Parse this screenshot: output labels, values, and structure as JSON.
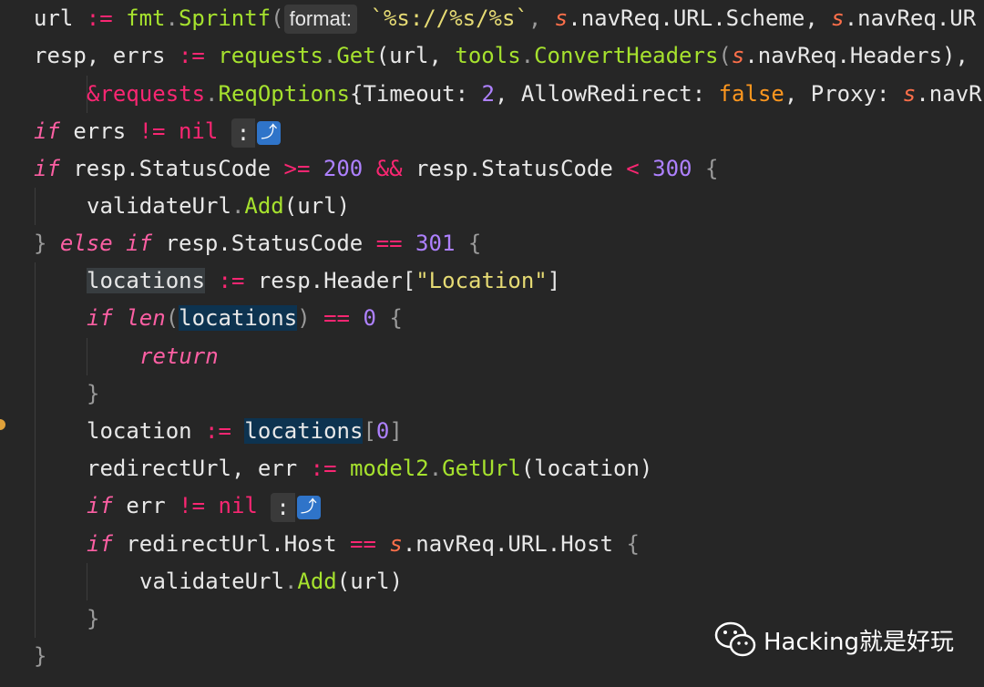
{
  "code": {
    "l1": {
      "a": "url",
      "b": " := ",
      "c": "fmt",
      "d": ".",
      "e": "Sprintf",
      "f": "(",
      "hint": "format:",
      "g": "`%s://%s/%s`",
      "h": ", ",
      "i": "s",
      "j": ".navReq.URL.Scheme, ",
      "k": "s",
      "l": ".navReq.UR"
    },
    "l2": {
      "a": "resp, errs",
      "b": " := ",
      "c": "requests",
      "d": ".",
      "e": "Get",
      "f": "(url, ",
      "g": "tools",
      "h": ".",
      "i": "ConvertHeaders",
      "j": "(",
      "k": "s",
      "l": ".navReq.Headers), "
    },
    "l3": {
      "a": "&requests",
      "b": ".",
      "c": "ReqOptions",
      "d": "{Timeout: ",
      "e": "2",
      "f": ", AllowRedirect: ",
      "g": "false",
      "h": ", Proxy: ",
      "i": "s",
      "j": ".navR"
    },
    "l4": {
      "a": "if",
      "b": " errs ",
      "c": "!=",
      "d": " nil",
      "colon": ":",
      "icon": "⤴"
    },
    "l5": {
      "a": "if",
      "b": " resp.StatusCode ",
      "c": ">=",
      "d": " 200 ",
      "e": "&&",
      "f": " resp.StatusCode ",
      "g": "<",
      "h": " 300 ",
      "i": "{"
    },
    "l6": {
      "a": "validateUrl",
      "b": ".",
      "c": "Add",
      "d": "(url)"
    },
    "l7": {
      "a": "}",
      "b": " else",
      "c": " if",
      "d": " resp.StatusCode ",
      "e": "==",
      "f": " 301 ",
      "g": "{"
    },
    "l8": {
      "a": "locations",
      "b": " := ",
      "c": "resp.Header[",
      "d": "\"Location\"",
      "e": "]"
    },
    "l9": {
      "a": "if",
      "b": " len",
      "c": "(",
      "d": "locations",
      "e": ") ",
      "f": "==",
      "g": " 0 ",
      "h": "{"
    },
    "l10": {
      "a": "return"
    },
    "l11": {
      "a": "}"
    },
    "l12": {
      "a": "location",
      "b": " := ",
      "c": "locations",
      "d": "[",
      "e": "0",
      "f": "]"
    },
    "l13": {
      "a": "redirectUrl, err",
      "b": " := ",
      "c": "model2",
      "d": ".",
      "e": "GetUrl",
      "f": "(location)"
    },
    "l14": {
      "a": "if",
      "b": " err ",
      "c": "!=",
      "d": " nil",
      "colon": ":",
      "icon": "⤴"
    },
    "l15": {
      "a": "if",
      "b": " redirectUrl.Host ",
      "c": "==",
      "d": " s",
      "e": ".navReq.URL.Host ",
      "f": "{"
    },
    "l16": {
      "a": "validateUrl",
      "b": ".",
      "c": "Add",
      "d": "(url)"
    },
    "l17": {
      "a": "}"
    },
    "l18": {
      "a": "}"
    }
  },
  "watermark": {
    "text": "Hacking就是好玩",
    "icon": "wechat-icon"
  },
  "colors": {
    "background": "#262626",
    "keyword": "#fc5fa3",
    "function": "#a6e22e",
    "string": "#e6db74",
    "number": "#ae81ff",
    "receiver": "#fd6f4a",
    "icon_blue": "#2f74c9"
  }
}
